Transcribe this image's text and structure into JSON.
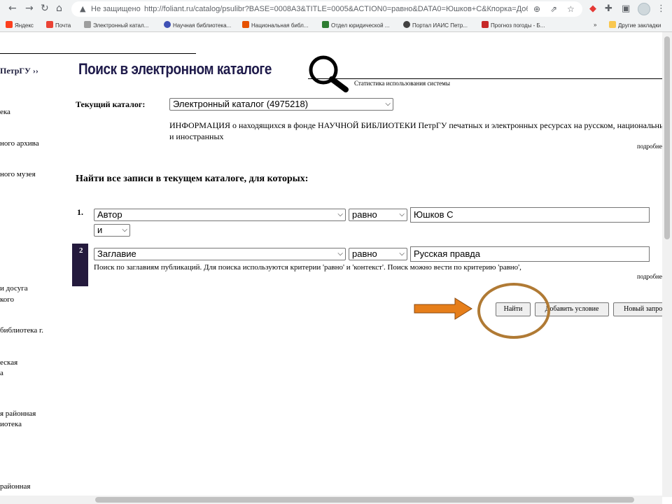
{
  "browser": {
    "security_label": "Не защищено",
    "url": "http://foliant.ru/catalog/psulibr?BASE=0008A3&TITLE=0005&ACTION0=равно&DATA0=Юшков+С&Кпорка=Добавить",
    "bookmarks": [
      {
        "label": "Яндекс",
        "color": "#fc3f1d"
      },
      {
        "label": "Почта",
        "color": "#ea4335"
      },
      {
        "label": "Электронный катал...",
        "color": "#9e9e9e"
      },
      {
        "label": "Научная библиотека...",
        "color": "#3f51b5"
      },
      {
        "label": "Национальная библ...",
        "color": "#e65100"
      },
      {
        "label": "Отдел юридической ...",
        "color": "#2e7d32"
      },
      {
        "label": "Портал ИАИС Петр...",
        "color": "#424242"
      },
      {
        "label": "Прогноз погоды - Б...",
        "color": "#c62828"
      }
    ],
    "more_bookmarks": "»",
    "other_bookmarks": "Другие закладки"
  },
  "sidebar": {
    "title": "ПетрГУ ››",
    "items": [
      "ека",
      "ного архива",
      "ного музея",
      "и досуга",
      "кого",
      "библиотека г.",
      "еская",
      "а",
      "я районная",
      "иотека",
      "районная"
    ]
  },
  "header": {
    "banner": "Поиск в электронном каталоге",
    "stats_link": "Статистика использования системы"
  },
  "catalog": {
    "label": "Текущий каталог:",
    "selected": "Электронный каталог (4975218)",
    "info": "ИНФОРМАЦИЯ о находящихся в фонде НАУЧНОЙ БИБЛИОТЕКИ ПетрГУ печатных и электронных ресурсах на русском, национальных и иностранных",
    "more": "подробнее"
  },
  "search": {
    "heading": "Найти все записи в текущем каталоге, для которых:",
    "rows": [
      {
        "number": "1.",
        "field": "Автор",
        "condition": "равно",
        "value": "Юшков С",
        "logic": "и"
      },
      {
        "number": "2",
        "field": "Заглавие",
        "condition": "равно",
        "value": "Русская правда"
      }
    ],
    "hint": "Поиск по заглавиям публикаций. Для поиска используются критерии 'равно' и 'контекст'. Поиск можно вести по критерию 'равно',",
    "hint_more": "подробнее"
  },
  "buttons": {
    "find": "Найти",
    "add_condition": "Добавить условие",
    "new_query": "Новый запрос"
  },
  "annotation_colors": {
    "arrow": "#e67e1a",
    "circle": "#b07a34"
  }
}
